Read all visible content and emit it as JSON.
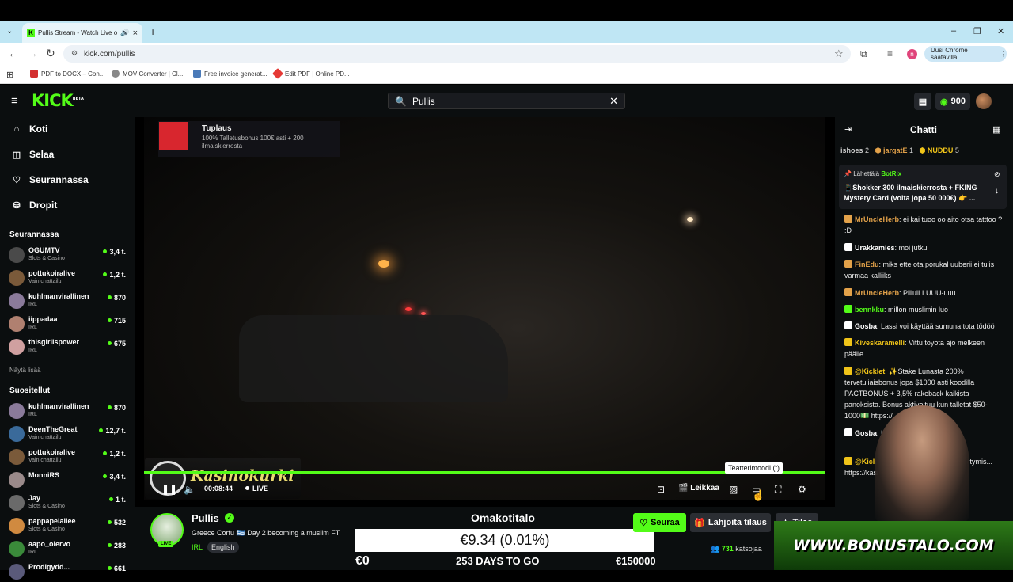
{
  "browser": {
    "tab_title": "Pullis Stream - Watch Live o",
    "url": "kick.com/pullis",
    "update_label": "Uusi Chrome saatavilla",
    "profile_initial": "n",
    "bookmarks": [
      "PDF to DOCX – Con...",
      "MOV Converter | Cl...",
      "Free invoice generat...",
      "Edit PDF | Online PD..."
    ]
  },
  "kick": {
    "logo": "KICK",
    "logo_beta": "BETA",
    "search_value": "Pullis",
    "kicks_balance": "900"
  },
  "sidebar": {
    "nav": [
      {
        "label": "Koti",
        "icon": "home-icon"
      },
      {
        "label": "Selaa",
        "icon": "browse-icon"
      },
      {
        "label": "Seurannassa",
        "icon": "heart-icon"
      },
      {
        "label": "Dropit",
        "icon": "drops-icon"
      }
    ],
    "following_title": "Seurannassa",
    "following": [
      {
        "name": "OGUMTV",
        "category": "Slots & Casino",
        "viewers": "3,4 t.",
        "color": "#4a4a4a"
      },
      {
        "name": "pottukoiralive",
        "category": "Vain chattailu",
        "viewers": "1,2 t.",
        "color": "#7a5a3a"
      },
      {
        "name": "kuhlmanvirallinen",
        "category": "IRL",
        "viewers": "870",
        "color": "#8a7a9a"
      },
      {
        "name": "iippadaa",
        "category": "IRL",
        "viewers": "715",
        "color": "#b08070"
      },
      {
        "name": "thisgirlispower",
        "category": "IRL",
        "viewers": "675",
        "color": "#d0a0a0"
      }
    ],
    "show_more": "Näytä lisää",
    "recommended_title": "Suositellut",
    "recommended": [
      {
        "name": "kuhlmanvirallinen",
        "category": "IRL",
        "viewers": "870",
        "color": "#8a7a9a"
      },
      {
        "name": "DeenTheGreat",
        "category": "Vain chattailu",
        "viewers": "12,7 t.",
        "color": "#3a6a9a"
      },
      {
        "name": "pottukoiralive",
        "category": "Vain chattailu",
        "viewers": "1,2 t.",
        "color": "#7a5a3a"
      },
      {
        "name": "MonniRS",
        "category": "",
        "viewers": "3,4 t.",
        "color": "#9a8a8a"
      },
      {
        "name": "Jay",
        "category": "Slots & Casino",
        "viewers": "1 t.",
        "color": "#6a6a6a"
      },
      {
        "name": "pappapelailee",
        "category": "Slots & Casino",
        "viewers": "532",
        "color": "#d08a40"
      },
      {
        "name": "aapo_olervo",
        "category": "IRL",
        "viewers": "283",
        "color": "#3a8a3a"
      },
      {
        "name": "Prodigydd...",
        "category": "",
        "viewers": "661",
        "color": "#5a5a7a"
      }
    ]
  },
  "player": {
    "ad_title": "Tuplaus",
    "ad_text": "100% Talletusbonus 100€ asti + 200 ilmaiskierrosta",
    "overlay_brand": "Kasinokurki",
    "time": "00:08:44",
    "live": "LIVE",
    "clip_label": "Leikkaa",
    "tooltip": "Teatterimoodi (t)",
    "progress": 1.0
  },
  "stream": {
    "streamer": "Pullis",
    "title": "Greece Corfu 🇬🇷 Day 2 becoming a muslim  FT",
    "category": "IRL",
    "language": "English",
    "live_badge": "LIVE",
    "follow_label": "Seuraa",
    "gift_label": "Lahjoita tilaus",
    "sub_label": "Tilaa",
    "viewers": "731",
    "viewers_label": "katsojaa"
  },
  "goal": {
    "title": "Omakotitalo",
    "amount": "€9.34 (0.01%)",
    "start": "€0",
    "days": "253 DAYS TO GO",
    "target": "€150000"
  },
  "chat": {
    "title": "Chatti",
    "leaders": [
      {
        "name": "ishoes",
        "count": "2"
      },
      {
        "name": "jargatE",
        "count": "1"
      },
      {
        "name": "NUDDU",
        "count": "5"
      }
    ],
    "pinned_by_label": "Lähettäjä",
    "pinned_by": "BotRix",
    "pinned_msg": "📱Shokker 300 ilmaiskierrosta + FKING Mystery Card (voita jopa 50 000€) 👉 ...",
    "messages": [
      {
        "user": "MrUncleHerb",
        "color": "#e3a24a",
        "text": "ei kai tuoo oo aito otsa tatttoo ? :D"
      },
      {
        "user": "Urakkamies",
        "color": "#ffffff",
        "text": "moi jutku"
      },
      {
        "user": "FinEdu",
        "color": "#e3a24a",
        "text": "miks ette ota porukal uuberii ei tulis varmaa kalliiks"
      },
      {
        "user": "MrUncleHerb",
        "color": "#e3a24a",
        "text": "PilluiLLUUU-uuu"
      },
      {
        "user": "bennkku",
        "color": "#53fc18",
        "text": "millon muslimin luo"
      },
      {
        "user": "Gosba",
        "color": "#ffffff",
        "text": "Lassi voi käyttää sumuna tota tödöö"
      },
      {
        "user": "Kiveskaramelli",
        "color": "#f0c419",
        "text": "Vittu toyota ajo melkeen päälle"
      },
      {
        "user": "@Kicklet",
        "color": "#f0c419",
        "text": "✨Stake Lunasta 200% tervetuliaisbonus jopa $1000 asti koodilla PACTBONUS + 3,5% rakeback kaikista panoksista. Bonus aktivoituu kun talletat $50-1000💵 https://...com/go/32"
      },
      {
        "user": "Gosba",
        "color": "#ffffff",
        "text": "Lassi v..."
      },
      {
        "user": "@Kick...",
        "color": "#f0c419",
        "text": "KarhuBetille! V... rekisteröitymis... https://kasinok..."
      }
    ]
  },
  "overlay": {
    "bonustalo": "WWW.BONUSTALO.COM"
  }
}
